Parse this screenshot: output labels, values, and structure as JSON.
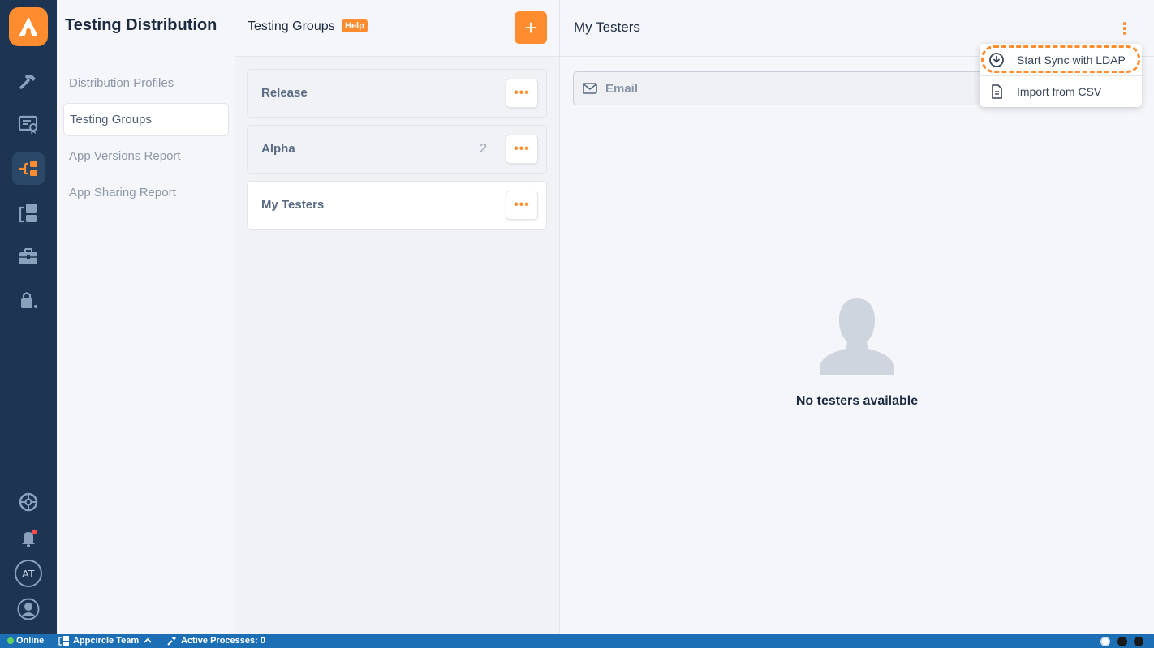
{
  "rail": {
    "icons": [
      "hammer-icon",
      "certificate-icon",
      "distribution-icon",
      "store-icon",
      "toolbox-icon",
      "lock-user-icon",
      "settings-icon",
      "bell-icon",
      "profile-icon"
    ],
    "active_icon": "distribution-icon",
    "avatar_initials": "AT"
  },
  "nav": {
    "title": "Testing Distribution",
    "items": [
      "Distribution Profiles",
      "Testing Groups",
      "App Versions Report",
      "App Sharing Report"
    ],
    "selected": "Testing Groups"
  },
  "groups": {
    "title": "Testing Groups",
    "help": "Help",
    "add": "+",
    "more": "•••",
    "items": [
      {
        "name": "Release",
        "count": ""
      },
      {
        "name": "Alpha",
        "count": "2"
      },
      {
        "name": "My Testers",
        "count": ""
      }
    ]
  },
  "main": {
    "title": "My Testers",
    "email_placeholder": "Email",
    "empty_text": "No testers available",
    "kebab": "⋮"
  },
  "menu": {
    "items": [
      "Start Sync with LDAP",
      "Import from CSV"
    ]
  },
  "status": {
    "online": "Online",
    "team": "Appcircle Team",
    "processes": "Active Processes: 0"
  },
  "colors": {
    "accent": "#ff8c2e",
    "rail": "#1d3553",
    "status_bar": "#1c6fb5"
  }
}
